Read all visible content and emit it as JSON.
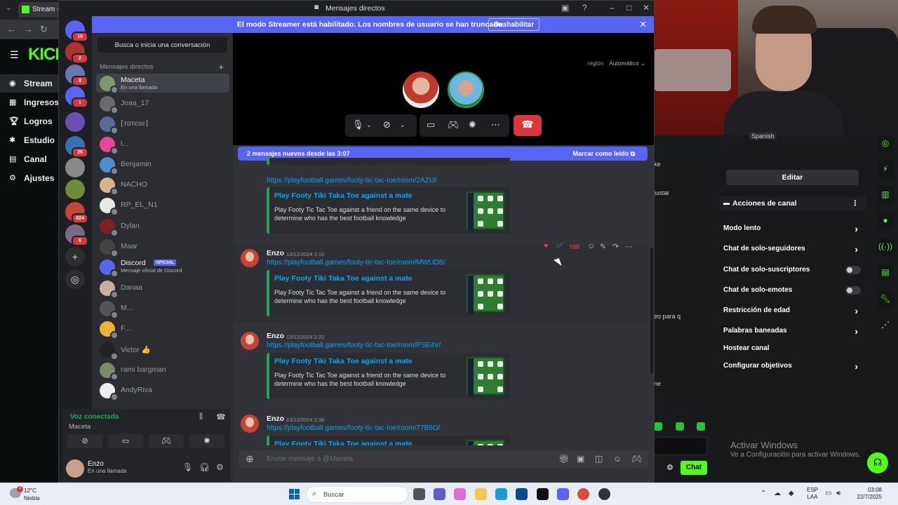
{
  "browser": {
    "tab_title": "Stream - K",
    "kick_logo": "KICK",
    "nav": [
      {
        "label": "Stream",
        "icon": "radio-icon"
      },
      {
        "label": "Ingresos",
        "icon": "chart-icon"
      },
      {
        "label": "Logros",
        "icon": "trophy-icon"
      },
      {
        "label": "Estudio",
        "icon": "studio-icon"
      },
      {
        "label": "Canal",
        "icon": "channel-icon"
      },
      {
        "label": "Ajustes",
        "icon": "gear-icon"
      }
    ],
    "right_panel": {
      "edit_button": "Editar",
      "actions_title": "Acciones de canal",
      "rows": [
        {
          "label": "Modo lento",
          "control": "chevron"
        },
        {
          "label": "Chat de solo-seguidores",
          "control": "chevron"
        },
        {
          "label": "Chat de solo-suscriptores",
          "control": "toggle",
          "on": false
        },
        {
          "label": "Chat de solo-emotes",
          "control": "toggle",
          "on": false
        },
        {
          "label": "Restricción de edad",
          "control": "chevron"
        },
        {
          "label": "Palabras baneadas",
          "control": "chevron"
        },
        {
          "label": "Hostear canal",
          "control": "none"
        },
        {
          "label": "Configurar objetivos",
          "control": "chevron"
        }
      ],
      "chat_button": "Chat",
      "partial_language": "Spanish",
      "partial_texts": [
        "ke",
        "justar",
        "eo para q",
        "ne"
      ]
    },
    "windows_activation": {
      "title": "Activar Windows",
      "subtitle": "Ve a Configuración para activar Windows."
    }
  },
  "discord": {
    "window_title": "Mensajes directos",
    "streamer_banner": {
      "message": "El modo Streamer está habilitado. Los nombres de usuario se han truncado.",
      "button": "Deshabilitar"
    },
    "servers": [
      {
        "badge": "15"
      },
      {
        "badge": "2"
      },
      {
        "badge": "8"
      },
      {
        "badge": "1"
      },
      {
        "badge": ""
      },
      {
        "badge": "25"
      },
      {
        "badge": ""
      },
      {
        "badge": ""
      },
      {
        "badge": "824"
      },
      {
        "badge": "6"
      }
    ],
    "search_placeholder": "Busca o inicia una conversación",
    "dm_header": "Mensajes directos",
    "dms": [
      {
        "name": "Maceta",
        "sub": "En una llamada",
        "selected": true,
        "color": "#7d9a6e"
      },
      {
        "name": "Joaa_17",
        "sub": "",
        "color": "#6b6b6b"
      },
      {
        "name": "⁅тατєѕє⁆",
        "sub": "",
        "color": "#5a6a9a"
      },
      {
        "name": "l...",
        "sub": "",
        "color": "#eb459e"
      },
      {
        "name": "Benjamin",
        "sub": "",
        "color": "#4b8fd0"
      },
      {
        "name": "NACHO",
        "sub": "",
        "color": "#d9b48a"
      },
      {
        "name": "RP_EL_N1",
        "sub": "",
        "color": "#e8e8e8"
      },
      {
        "name": "Dylan",
        "sub": "",
        "color": "#7a2424"
      },
      {
        "name": "Maar",
        "sub": "",
        "color": "#444"
      },
      {
        "name": "Discord",
        "sub": "Mensaje oficial de Discord",
        "official": "OFICIAL",
        "color": "#5865f2"
      },
      {
        "name": "Danaa",
        "sub": "",
        "color": "#c8b0a0"
      },
      {
        "name": "M...",
        "sub": "",
        "color": "#555"
      },
      {
        "name": "F...",
        "sub": "",
        "color": "#f0b232"
      },
      {
        "name": "Victor 👍",
        "sub": "",
        "color": "#222"
      },
      {
        "name": "rami bargman",
        "sub": "",
        "color": "#7a8a6a"
      },
      {
        "name": "AndyRiva",
        "sub": "",
        "color": "#eee"
      }
    ],
    "voice": {
      "title": "Voz conectada",
      "channel": "Maceta"
    },
    "user": {
      "name": "Enzo",
      "status": "En una llamada"
    },
    "call": {
      "region_label": "región",
      "region_value": "Automático"
    },
    "new_messages": {
      "text": "2 mensajes nuevos desde las 3:07",
      "mark_read": "Marcar como leído"
    },
    "messages": [
      {
        "author": "",
        "time": "",
        "link": "https://playfootball.games/footy-tic-tac-toe/room/2AZIJ/",
        "embed_title": "Play Footy Tiki Taka Toe against a mate",
        "embed_desc": "Play Footy Tic Tac Toe against a friend on the same device to determine who has the best football knowledge"
      },
      {
        "author": "Enzo",
        "time": "13/12/2024 2:10",
        "link": "https://playfootball.games/footy-tic-tac-toe/room/MWUDB/",
        "embed_title": "Play Footy Tiki Taka Toe against a mate",
        "embed_desc": "Play Footy Tic Tac Toe against a friend on the same device to determine who has the best football knowledge"
      },
      {
        "author": "Enzo",
        "time": "13/12/2024 2:22",
        "link": "https://playfootball.games/footy-tic-tac-toe/room/PSE4V/",
        "embed_title": "Play Footy Tiki Taka Toe against a mate",
        "embed_desc": "Play Footy Tic Tac Toe against a friend on the same device to determine who has the best football knowledge"
      },
      {
        "author": "Enzo",
        "time": "13/12/2024 2:38",
        "link": "https://playfootball.games/footy-tic-tac-toe/room/77B6O/",
        "embed_title": "Play Footy Tiki Taka Toe against a mate",
        "embed_desc": ""
      }
    ],
    "input_placeholder": "Enviar mensaje a @Maceta"
  },
  "taskbar": {
    "weather_temp": "12°C",
    "weather_desc": "Niebla",
    "weather_badge": "4",
    "search_placeholder": "Buscar",
    "lang_line1": "ESP",
    "lang_line2": "LAA",
    "time": "03:08",
    "date": "22/7/2025"
  }
}
